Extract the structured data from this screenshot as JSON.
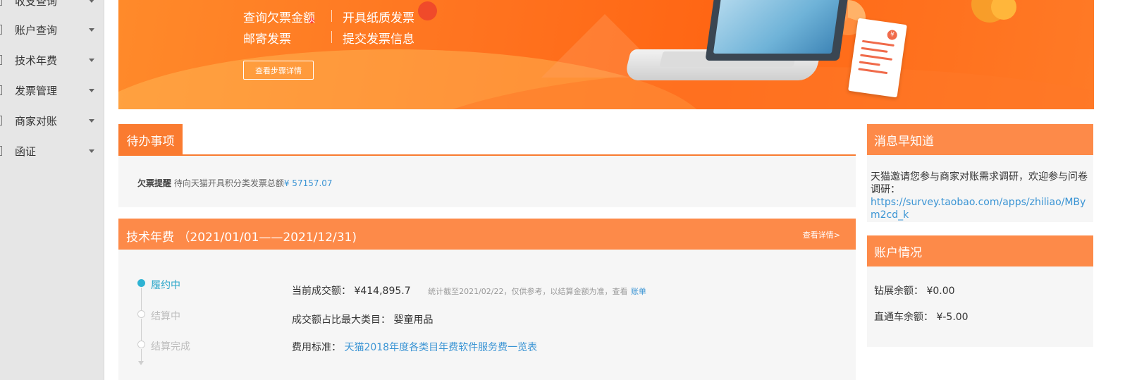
{
  "sidebar": {
    "items": [
      {
        "label": "收支查询"
      },
      {
        "label": "账户查询"
      },
      {
        "label": "技术年费"
      },
      {
        "label": "发票管理"
      },
      {
        "label": "商家对账"
      },
      {
        "label": "函证"
      }
    ]
  },
  "banner": {
    "line1_left": "查询欠票金额",
    "line1_right": "开具纸质发票",
    "line2_left": "邮寄发票",
    "line2_right": "提交发票信息",
    "button": "查看步骤详情",
    "receipt_symbol": "¥"
  },
  "todo": {
    "tab": "待办事项",
    "label": "欠票提醒",
    "text": "待向天猫开具积分类发票总额",
    "amount": "¥ 57157.07"
  },
  "fee": {
    "title": "技术年费 （2021/01/01——2021/12/31)",
    "link": "查看详情>",
    "steps": [
      {
        "label": "履约中",
        "active": true
      },
      {
        "label": "结算中",
        "active": false
      },
      {
        "label": "结算完成",
        "active": false
      }
    ],
    "row1_label": "当前成交额：",
    "row1_value": "¥414,895.7",
    "row1_note": "统计截至2021/02/22，仅供参考，以结算金额为准，查看",
    "row1_link": "账单",
    "row2_label": "成交额占比最大类目：",
    "row2_value": "婴童用品",
    "row3_label": "费用标准：",
    "row3_link": "天猫2018年度各类目年费软件服务费一览表"
  },
  "news": {
    "title": "消息早知道",
    "text": "天猫邀请您参与商家对账需求调研，欢迎参与问卷调研：",
    "link": "https://survey.taobao.com/apps/zhiliao/MBym2cd_k"
  },
  "account": {
    "title": "账户情况",
    "zuanzhan_label": "钻展余额：",
    "zuanzhan_value": "¥0.00",
    "ztc_label": "直通车余额：",
    "ztc_value": "¥-5.00"
  },
  "colors": {
    "accent": "#fa7b30",
    "panel_header": "#fd8a49",
    "link": "#3a94d4",
    "step_active": "#2aa6c9"
  }
}
